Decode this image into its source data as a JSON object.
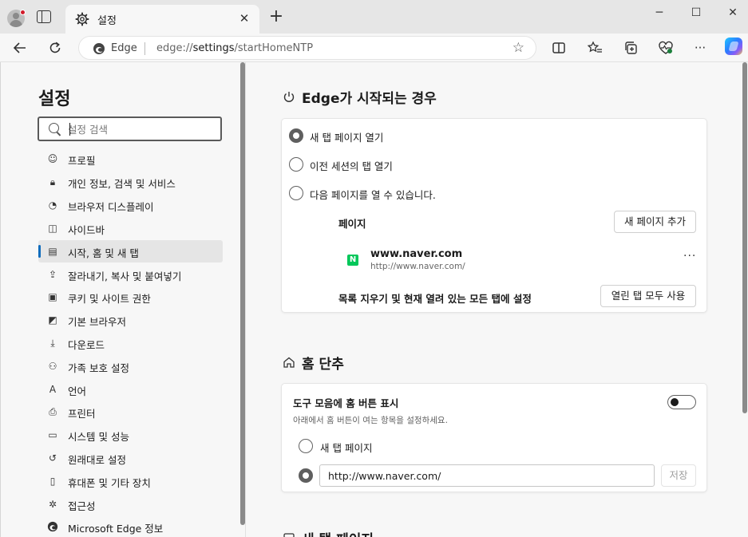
{
  "browser": {
    "tab_title": "설정",
    "tab_close_icon": "close-icon",
    "new_tab_glyph": "+",
    "address": {
      "edge_label": "Edge",
      "url_prefix": "edge://",
      "url_main": "settings",
      "url_rest": "/startHomeNTP"
    }
  },
  "sidebar": {
    "title": "설정",
    "search_placeholder": "설정 검색",
    "items": [
      {
        "label": "프로필",
        "icon": "profile-icon"
      },
      {
        "label": "개인 정보, 검색 및 서비스",
        "icon": "lock-icon"
      },
      {
        "label": "브라우저 디스플레이",
        "icon": "palette-icon"
      },
      {
        "label": "사이드바",
        "icon": "sidebar-icon"
      },
      {
        "label": "시작, 홈 및 새 탭",
        "icon": "home-grid-icon",
        "active": true
      },
      {
        "label": "잘라내기, 복사 및 붙여넣기",
        "icon": "share-icon"
      },
      {
        "label": "쿠키 및 사이트 권한",
        "icon": "cookie-icon"
      },
      {
        "label": "기본 브라우저",
        "icon": "default-browser-icon"
      },
      {
        "label": "다운로드",
        "icon": "download-icon"
      },
      {
        "label": "가족 보호 설정",
        "icon": "family-icon"
      },
      {
        "label": "언어",
        "icon": "language-icon"
      },
      {
        "label": "프린터",
        "icon": "printer-icon"
      },
      {
        "label": "시스템 및 성능",
        "icon": "laptop-icon"
      },
      {
        "label": "원래대로 설정",
        "icon": "reset-icon"
      },
      {
        "label": "휴대폰 및 기타 장치",
        "icon": "phone-icon"
      },
      {
        "label": "접근성",
        "icon": "accessibility-icon"
      },
      {
        "label": "Microsoft Edge 정보",
        "icon": "edge-icon"
      }
    ]
  },
  "startup": {
    "title": "Edge가 시작되는 경우",
    "options": [
      {
        "label": "새 탭 페이지 열기",
        "selected": true
      },
      {
        "label": "이전 세션의 탭 열기",
        "selected": false
      },
      {
        "label": "다음 페이지를 열 수 있습니다.",
        "selected": false
      }
    ],
    "pages_label": "페이지",
    "add_page_button": "새 페이지 추가",
    "page": {
      "title": "www.naver.com",
      "url": "http://www.naver.com/",
      "favicon_letter": "N"
    },
    "clear_label": "목록 지우기 및 현재 열려 있는 모든 탭에 설정",
    "use_open_tabs_button": "열린 탭 모두 사용"
  },
  "home_button": {
    "title": "홈 단추",
    "toggle_label": "도구 모음에 홈 버튼 표시",
    "toggle_on": false,
    "description": "아래에서 홈 버튼이 여는 항목을 설정하세요.",
    "option_new_tab": "새 탭 페이지",
    "url_value": "http://www.naver.com/",
    "save_button": "저장"
  },
  "next_section_partial": "새 탭 페이지"
}
